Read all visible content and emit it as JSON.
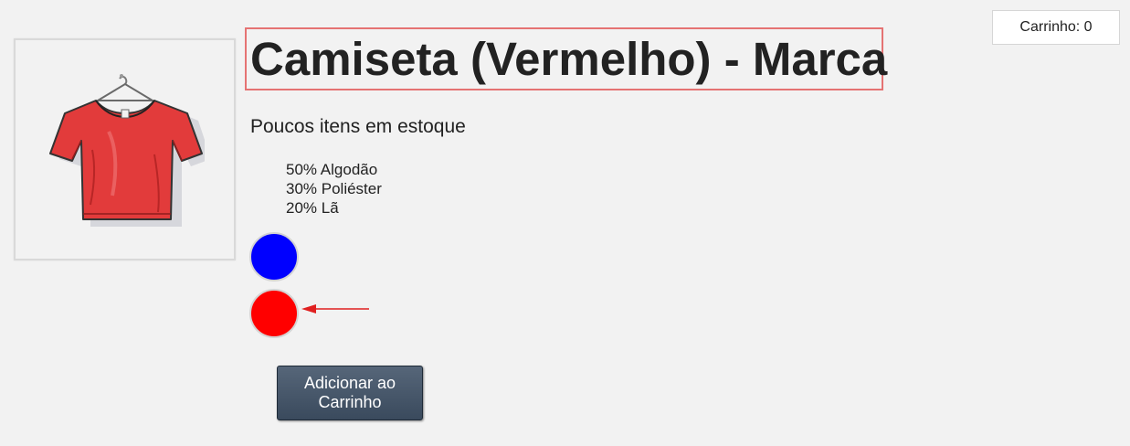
{
  "cart": {
    "label": "Carrinho: 0"
  },
  "product": {
    "title": "Camiseta (Vermelho) - Marca",
    "image_alt": "red-tshirt-on-hanger",
    "stock_status": "Poucos itens em estoque",
    "materials": [
      "50% Algodão",
      "30% Poliéster",
      "20% Lã"
    ],
    "colors": [
      {
        "name": "blue",
        "hex": "#0000ff"
      },
      {
        "name": "red",
        "hex": "#ff0000"
      }
    ],
    "selected_color": "red"
  },
  "actions": {
    "add_to_cart_label": "Adicionar ao Carrinho"
  },
  "annotation": {
    "highlight_color": "#e57373",
    "arrow_color": "#e02020"
  }
}
